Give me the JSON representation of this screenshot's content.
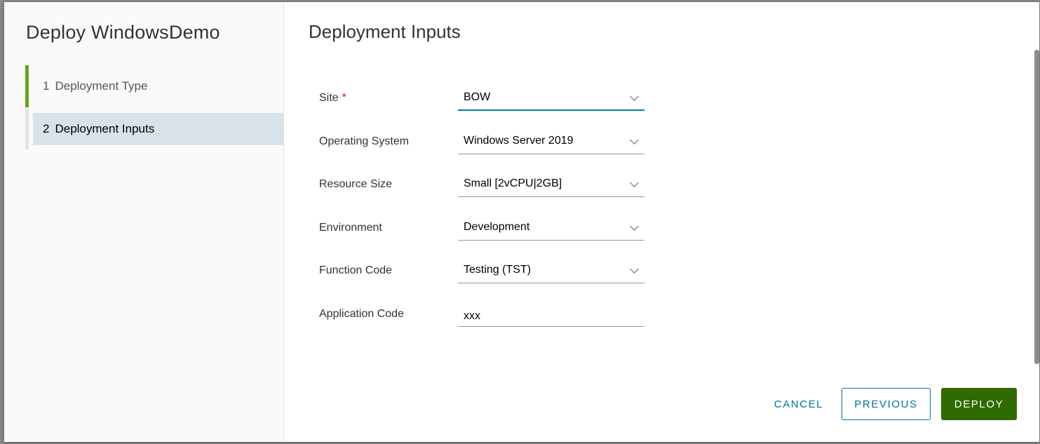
{
  "wizard": {
    "title": "Deploy WindowsDemo",
    "steps": [
      {
        "number": "1",
        "label": "Deployment Type"
      },
      {
        "number": "2",
        "label": "Deployment Inputs"
      }
    ]
  },
  "page": {
    "title": "Deployment Inputs"
  },
  "form": {
    "site": {
      "label": "Site",
      "required_mark": "*",
      "value": "BOW"
    },
    "os": {
      "label": "Operating System",
      "value": "Windows Server 2019"
    },
    "resource_size": {
      "label": "Resource Size",
      "value": "Small [2vCPU|2GB]"
    },
    "environment": {
      "label": "Environment",
      "value": "Development"
    },
    "function_code": {
      "label": "Function Code",
      "value": "Testing (TST)"
    },
    "application_code": {
      "label": "Application Code",
      "value": "xxx"
    }
  },
  "buttons": {
    "cancel": "CANCEL",
    "previous": "PREVIOUS",
    "deploy": "DEPLOY"
  },
  "colors": {
    "accent": "#0072a3",
    "primary_button": "#2f6b00",
    "step_done": "#62a420",
    "active_step_bg": "#d8e3e9",
    "required": "#c92100"
  }
}
